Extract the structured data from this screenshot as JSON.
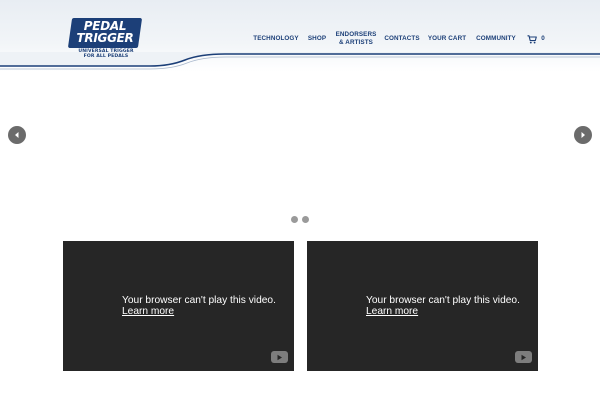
{
  "header": {
    "logo": {
      "line1": "PEDAL",
      "line2": "TRIGGER",
      "tagline1": "UNIVERSAL TRIGGER",
      "tagline2": "FOR ALL PEDALS",
      "brand_color": "#1c3f78"
    },
    "nav": {
      "items": [
        {
          "label": "TECHNOLOGY"
        },
        {
          "label": "SHOP"
        },
        {
          "label": "ENDORSERS & ARTISTS"
        },
        {
          "label": "CONTACTS"
        },
        {
          "label": "YOUR CART"
        },
        {
          "label": "COMMUNITY"
        }
      ],
      "cart": {
        "icon": "shopping-cart-icon",
        "count": "0"
      }
    }
  },
  "slider": {
    "prev_icon": "chevron-left-icon",
    "next_icon": "chevron-right-icon",
    "dots": 2
  },
  "videos": [
    {
      "message": "Your browser can't play this video.",
      "link": "Learn more",
      "icon": "youtube-play-icon"
    },
    {
      "message": "Your browser can't play this video.",
      "link": "Learn more",
      "icon": "youtube-play-icon"
    }
  ],
  "colors": {
    "nav_text": "#1c3f78",
    "video_bg": "#262626",
    "arrow_bg": "#6b6b6b"
  }
}
